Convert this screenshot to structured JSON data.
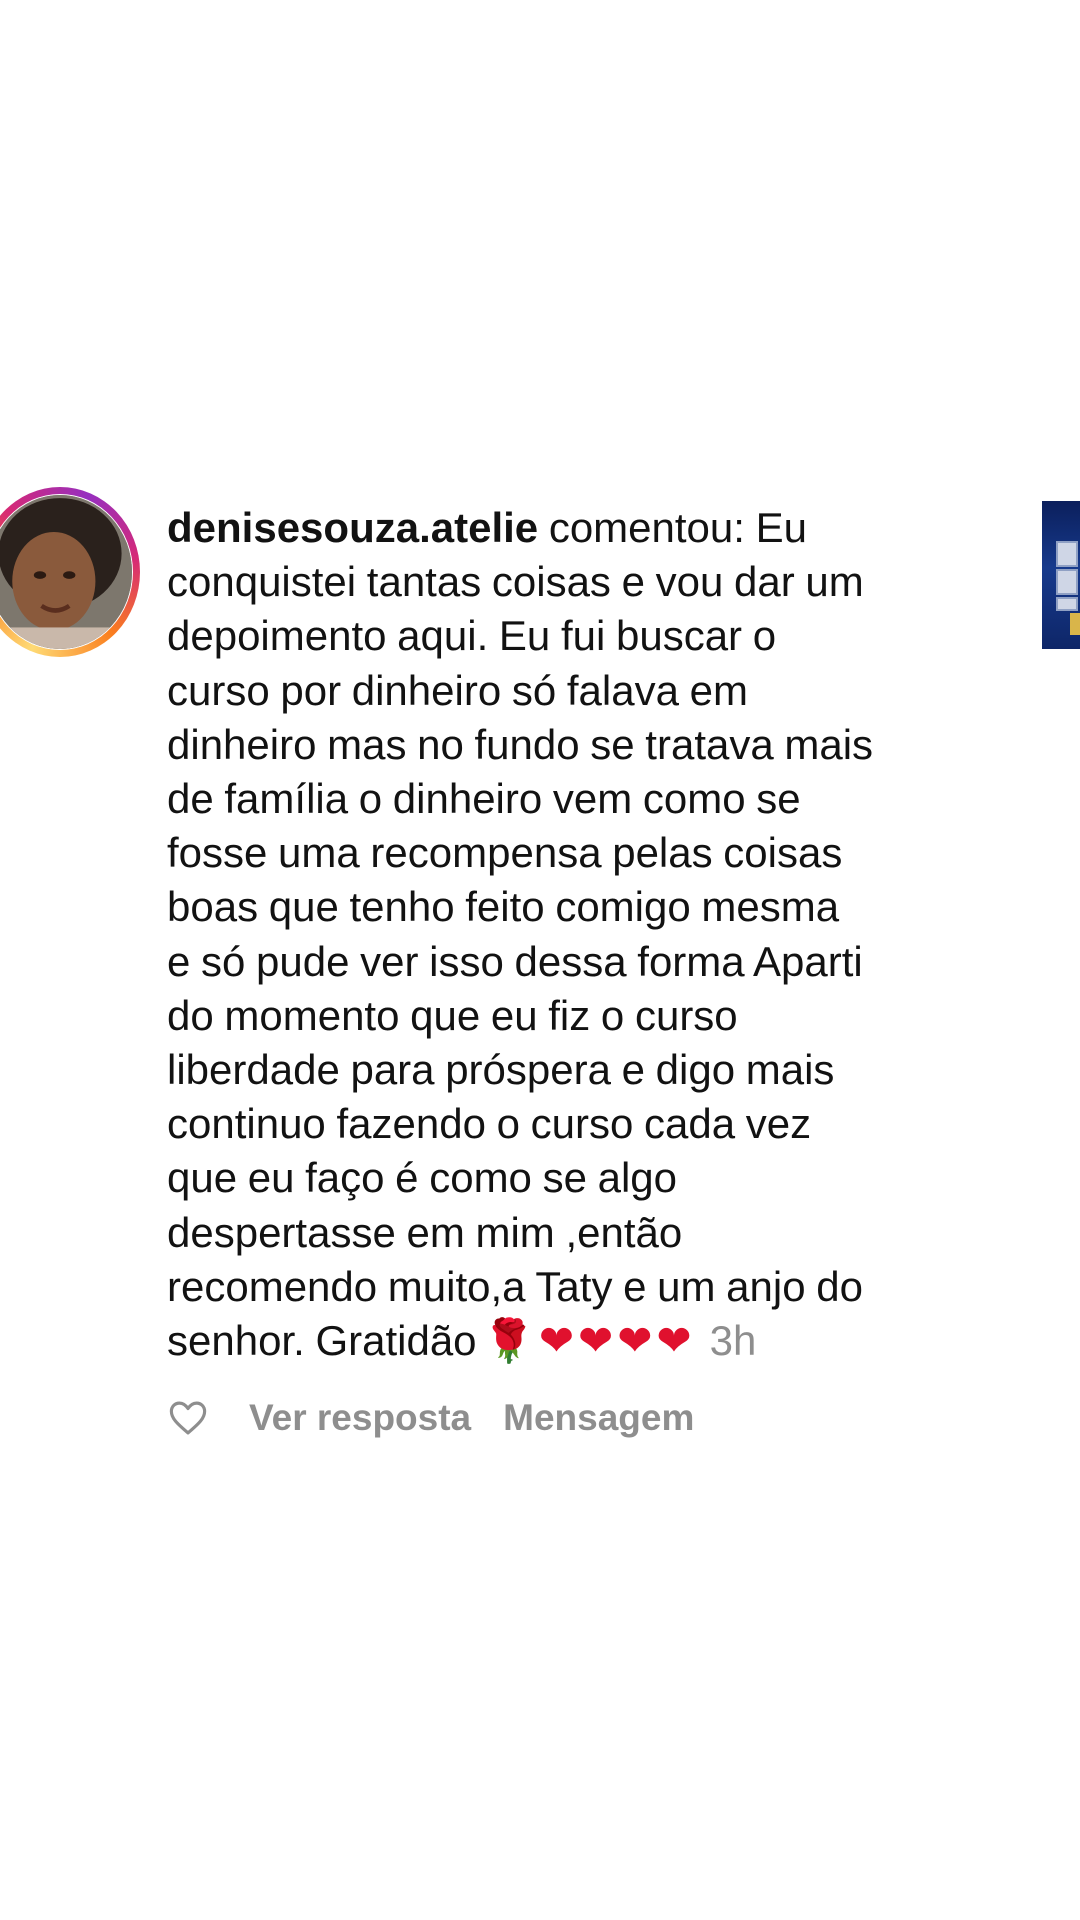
{
  "notification": {
    "username": "denisesouza.atelie",
    "action_text": " comentou: ",
    "comment": "Eu\nconquistei tantas coisas e vou dar um\ndepoimento aqui.  Eu fui buscar o\ncurso por dinheiro só falava em\ndinheiro mas no fundo se tratava mais\nde família o dinheiro vem como se\nfosse uma recompensa pelas coisas\nboas que tenho feito comigo mesma\ne só pude ver isso dessa forma Aparti\ndo momento que eu fiz o curso\nliberdade para próspera e digo mais\ncontinuo fazendo o curso cada vez\nque eu faço é como se algo\ndespertasse  em mim ,então\nrecomendo muito,a Taty e um anjo do\nsenhor. Gratidão",
    "emoji_rose": "🌹",
    "emoji_hearts": "❤❤❤❤",
    "timestamp": "3h",
    "actions": {
      "like_icon": "heart-outline-icon",
      "reply_label": "Ver resposta",
      "message_label": "Mensagem"
    }
  },
  "colors": {
    "text": "#121212",
    "secondary_text": "#8e8e8e",
    "heart": "#e0112e",
    "story_ring": [
      "#feda75",
      "#fa7e1e",
      "#d62976",
      "#962fbf"
    ]
  }
}
